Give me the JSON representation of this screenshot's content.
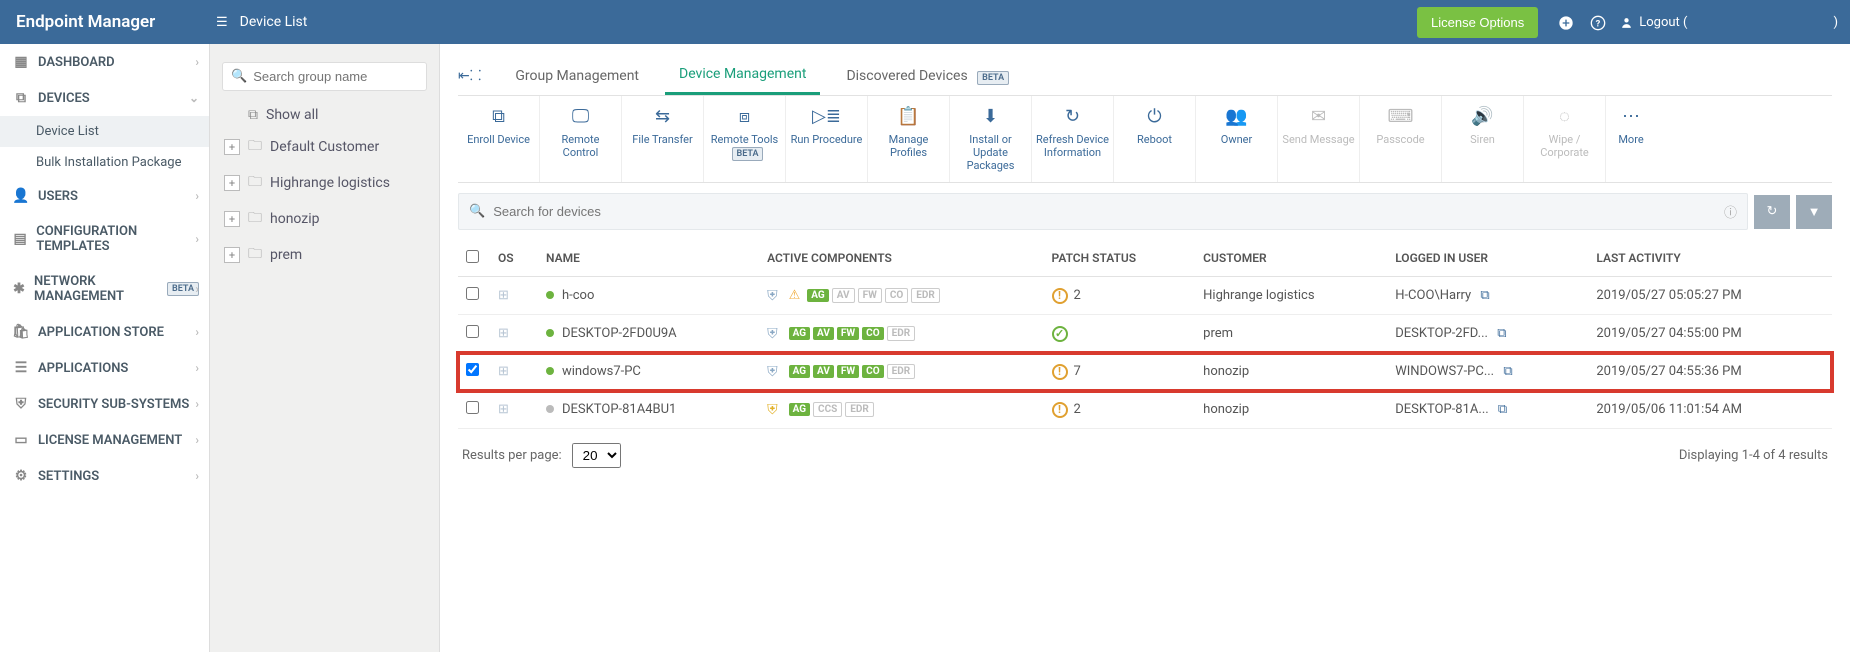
{
  "brand": "Endpoint Manager",
  "header": {
    "breadcrumb": "Device List",
    "license_btn": "License Options",
    "logout": "Logout ("
  },
  "sidebar": {
    "items": [
      {
        "label": "DASHBOARD",
        "icon": "dashboard"
      },
      {
        "label": "DEVICES",
        "icon": "devices",
        "expanded": true,
        "sub": [
          {
            "label": "Device List",
            "active": true
          },
          {
            "label": "Bulk Installation Package"
          }
        ]
      },
      {
        "label": "USERS",
        "icon": "user"
      },
      {
        "label": "CONFIGURATION TEMPLATES",
        "icon": "templates"
      },
      {
        "label": "NETWORK MANAGEMENT",
        "icon": "network",
        "beta": true
      },
      {
        "label": "APPLICATION STORE",
        "icon": "store"
      },
      {
        "label": "APPLICATIONS",
        "icon": "apps"
      },
      {
        "label": "SECURITY SUB-SYSTEMS",
        "icon": "shield"
      },
      {
        "label": "LICENSE MANAGEMENT",
        "icon": "license"
      },
      {
        "label": "SETTINGS",
        "icon": "gear"
      }
    ],
    "beta_label": "BETA"
  },
  "groups": {
    "search_placeholder": "Search group name",
    "show_all": "Show all",
    "items": [
      "Default Customer",
      "Highrange logistics",
      "honozip",
      "prem"
    ]
  },
  "tabs": {
    "group": "Group Management",
    "device": "Device Management",
    "discovered": "Discovered Devices",
    "beta": "BETA"
  },
  "toolbar": {
    "enroll": "Enroll Device",
    "remote": "Remote Control",
    "filetransfer": "File Transfer",
    "remotetools": "Remote Tools",
    "remotetools_beta": "BETA",
    "runproc": "Run Procedure",
    "profiles": "Manage Profiles",
    "install": "Install or Update Packages",
    "refresh": "Refresh Device Information",
    "reboot": "Reboot",
    "owner": "Owner",
    "sendmsg": "Send Message",
    "passcode": "Passcode",
    "siren": "Siren",
    "wipe": "Wipe / Corporate",
    "more": "More"
  },
  "search": {
    "placeholder": "Search for devices"
  },
  "columns": {
    "os": "OS",
    "name": "NAME",
    "active": "ACTIVE COMPONENTS",
    "patch": "PATCH STATUS",
    "customer": "CUSTOMER",
    "user": "LOGGED IN USER",
    "activity": "LAST ACTIVITY"
  },
  "rows": [
    {
      "name": "h-coo",
      "status": "green",
      "warn": true,
      "comps": {
        "AG": true,
        "AV": false,
        "FW": false,
        "CO": false,
        "EDR": false
      },
      "patch": "warn",
      "patch_count": "2",
      "customer": "Highrange logistics",
      "user": "H-COO\\Harry",
      "activity": "2019/05/27 05:05:27 PM"
    },
    {
      "name": "DESKTOP-2FD0U9A",
      "status": "green",
      "comps": {
        "AG": true,
        "AV": true,
        "FW": true,
        "CO": true,
        "EDR": false
      },
      "patch": "ok",
      "patch_count": "",
      "customer": "prem",
      "user": "DESKTOP-2FD...",
      "activity": "2019/05/27 04:55:00 PM"
    },
    {
      "name": "windows7-PC",
      "status": "green",
      "hl": true,
      "checked": true,
      "comps": {
        "AG": true,
        "AV": true,
        "FW": true,
        "CO": true,
        "EDR": false
      },
      "patch": "warn",
      "patch_count": "7",
      "customer": "honozip",
      "user": "WINDOWS7-PC...",
      "activity": "2019/05/27 04:55:36 PM"
    },
    {
      "name": "DESKTOP-81A4BU1",
      "status": "grey",
      "gold_shield": true,
      "comps": {
        "AG": true,
        "CCS": false,
        "EDR": false
      },
      "patch": "warn",
      "patch_count": "2",
      "customer": "honozip",
      "user": "DESKTOP-81A...",
      "activity": "2019/05/06 11:01:54 AM"
    }
  ],
  "pager": {
    "label": "Results per page:",
    "value": "20",
    "summary": "Displaying 1-4 of 4 results"
  }
}
